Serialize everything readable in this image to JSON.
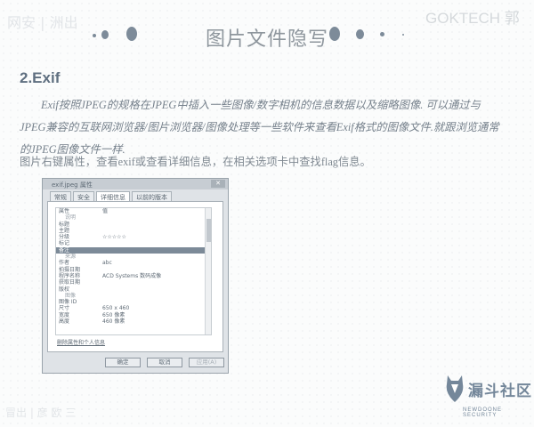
{
  "header": {
    "title": "图片文件隐写",
    "watermark_right": "GOKTECH 郭",
    "watermark_left": "网安 | 洲出"
  },
  "section": {
    "heading": "2.Exif",
    "paragraph": "Exif按照JPEG的规格在JPEG中插入一些图像/数字相机的信息数据以及缩略图像. 可以通过与JPEG兼容的互联网浏览器/图片浏览器/图像处理等一些软件来查看Exif格式的图像文件.就跟浏览通常的JPEG图像文件一样.",
    "instruction": "图片右键属性，查看exif或查看详细信息，在相关选项卡中查找flag信息。"
  },
  "dialog": {
    "title": "exif.jpeg 属性",
    "close": "✕",
    "tabs": [
      "常规",
      "安全",
      "详细信息",
      "以前的版本"
    ],
    "active_tab": "详细信息",
    "header": {
      "k": "属性",
      "v": "值"
    },
    "rows": [
      {
        "k": "说明",
        "v": "",
        "sec": true
      },
      {
        "k": "标题",
        "v": ""
      },
      {
        "k": "主题",
        "v": ""
      },
      {
        "k": "分级",
        "v": "☆☆☆☆☆"
      },
      {
        "k": "标记",
        "v": ""
      },
      {
        "k": "备注",
        "v": "",
        "sel": true
      },
      {
        "k": "来源",
        "v": "",
        "sec": true
      },
      {
        "k": "作者",
        "v": "abc"
      },
      {
        "k": "拍摄日期",
        "v": ""
      },
      {
        "k": "程序名称",
        "v": "ACD Systems 数码成像"
      },
      {
        "k": "获取日期",
        "v": ""
      },
      {
        "k": "版权",
        "v": ""
      },
      {
        "k": "图像",
        "v": "",
        "sec": true
      },
      {
        "k": "图像 ID",
        "v": ""
      },
      {
        "k": "尺寸",
        "v": "650 x 460"
      },
      {
        "k": "宽度",
        "v": "650 像素"
      },
      {
        "k": "高度",
        "v": "460 像素"
      }
    ],
    "remove_link": "删除属性和个人信息",
    "buttons": {
      "ok": "确定",
      "cancel": "取消",
      "apply": "应用(A)"
    }
  },
  "footer": {
    "logo_text": "漏斗社区",
    "logo_sub": "NEWDOONE SECURITY",
    "watermark": "冒出 | 彦 欧 三"
  },
  "colors": {
    "accent": "#7d8b99",
    "selection": "#7c8a98"
  }
}
